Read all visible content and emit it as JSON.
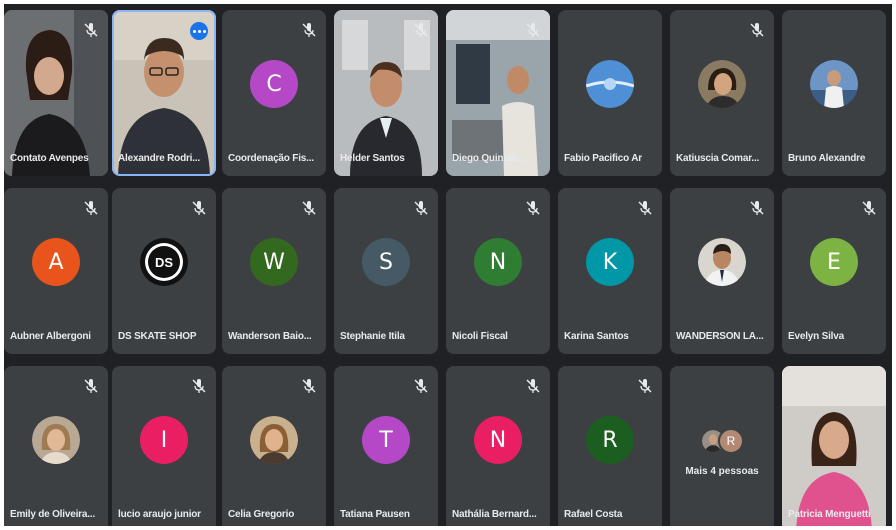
{
  "participants": [
    {
      "name": "Contato Avenpes"
    },
    {
      "name": "Alexandre Rodri..."
    },
    {
      "name": "Coordenação Fis...",
      "initial": "C",
      "color": "#b548c6"
    },
    {
      "name": "Helder Santos"
    },
    {
      "name": "Diego Quintan..."
    },
    {
      "name": "Fabio Pacifico Ar"
    },
    {
      "name": "Katiuscia Comar..."
    },
    {
      "name": "Bruno Alexandre"
    },
    {
      "name": "Aubner Albergoni",
      "initial": "A",
      "color": "#e8541c"
    },
    {
      "name": "DS SKATE SHOP",
      "logo_text": "DS"
    },
    {
      "name": "Wanderson Baio...",
      "initial": "W",
      "color": "#33691e"
    },
    {
      "name": "Stephanie Itila",
      "initial": "S",
      "color": "#455a64"
    },
    {
      "name": "Nicoli Fiscal",
      "initial": "N",
      "color": "#2e7d32"
    },
    {
      "name": "Karina Santos",
      "initial": "K",
      "color": "#0097a7"
    },
    {
      "name": "WANDERSON LA..."
    },
    {
      "name": "Evelyn Silva",
      "initial": "E",
      "color": "#7cb342"
    },
    {
      "name": "Emily de Oliveira..."
    },
    {
      "name": "lucio araujo junior",
      "initial": "I",
      "color": "#e91e63"
    },
    {
      "name": "Celia Gregorio"
    },
    {
      "name": "Tatiana Pausen",
      "initial": "T",
      "color": "#b548c6"
    },
    {
      "name": "Nathália Bernard...",
      "initial": "N",
      "color": "#e91e63"
    },
    {
      "name": "Rafael Costa",
      "initial": "R",
      "color": "#1b5e20"
    },
    {
      "more_label": "Mais 4 pessoas",
      "more_initial": "R"
    },
    {
      "name": "Patricia Menguetti"
    }
  ],
  "colors": {
    "background": "#202124",
    "tile": "#3c4043",
    "highlight": "#8ab4f8",
    "more_options": "#1a73e8"
  }
}
